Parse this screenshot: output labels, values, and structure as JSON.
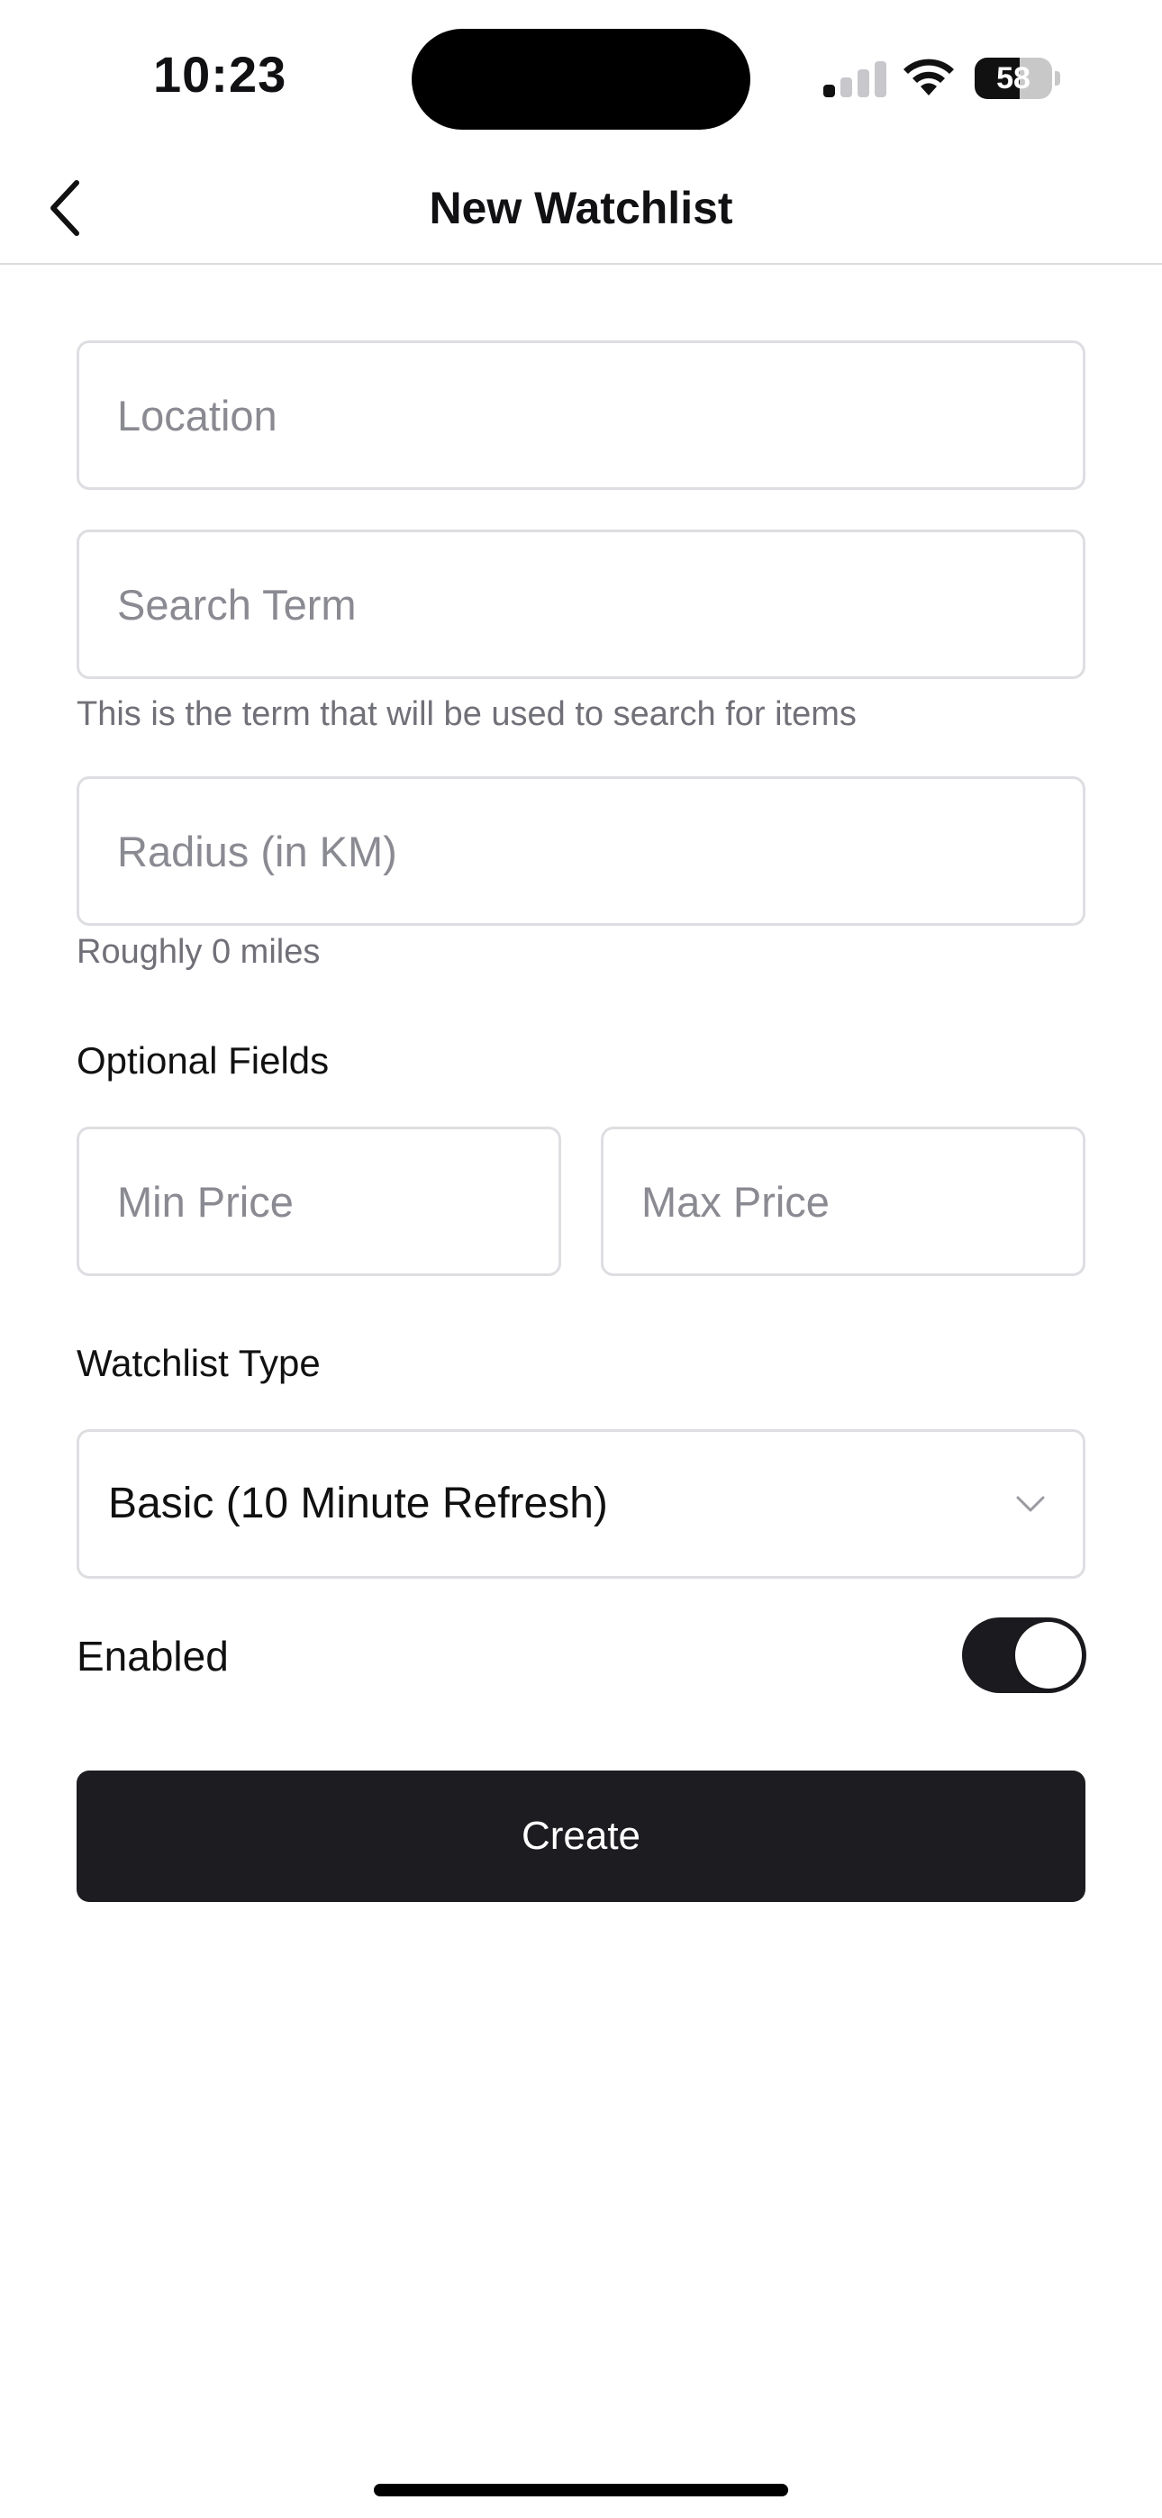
{
  "status_bar": {
    "time": "10:23",
    "battery_level": "58"
  },
  "nav": {
    "title": "New Watchlist",
    "back_icon": "chevron-left-icon"
  },
  "form": {
    "location": {
      "placeholder": "Location",
      "value": ""
    },
    "search_term": {
      "placeholder": "Search Term",
      "value": "",
      "helper": "This is the term that will be used to search for items"
    },
    "radius": {
      "placeholder": "Radius (in KM)",
      "value": "",
      "helper": "Roughly 0 miles"
    },
    "optional_label": "Optional Fields",
    "min_price": {
      "placeholder": "Min Price",
      "value": ""
    },
    "max_price": {
      "placeholder": "Max Price",
      "value": ""
    },
    "watchlist_type_label": "Watchlist Type",
    "watchlist_type": {
      "selected": "Basic (10 Minute Refresh)",
      "icon": "chevron-down-icon"
    },
    "enabled": {
      "label": "Enabled",
      "on": true
    },
    "create_label": "Create"
  },
  "colors": {
    "primary": "#1c1c21",
    "border": "#dedee2",
    "placeholder": "#8a8a92",
    "helper": "#707078"
  }
}
